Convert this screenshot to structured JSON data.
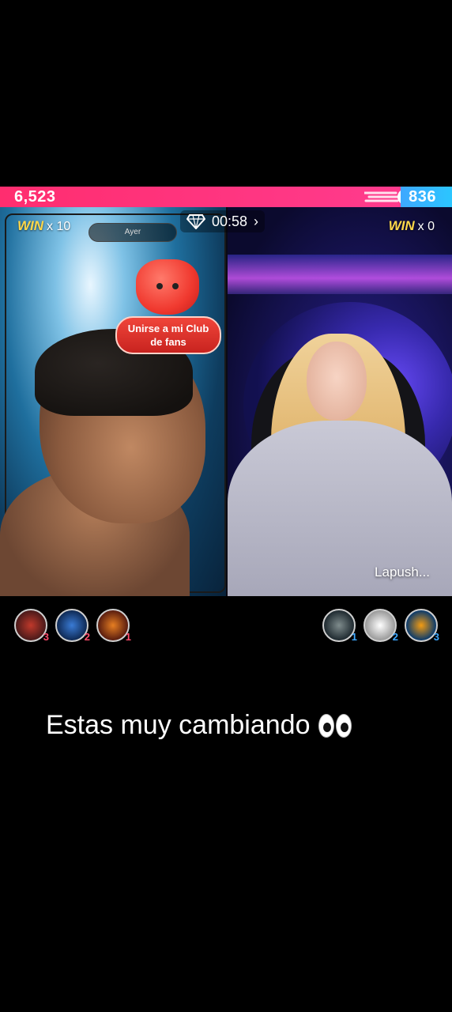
{
  "battle": {
    "left_score": "6,523",
    "right_score": "836",
    "left_share": 0.886,
    "colors": {
      "left": "#ff2d6f",
      "right": "#3ea8ff"
    }
  },
  "timer": {
    "icon": "diamond-icon",
    "value": "00:58",
    "chevron": "›"
  },
  "left_host": {
    "win_word": "WIN",
    "win_count": "x 10",
    "notch_text": "Ayer",
    "fanclub": {
      "line1": "Unirse a mi Club",
      "line2": "de fans"
    }
  },
  "right_host": {
    "win_word": "WIN",
    "win_count": "x 0",
    "name": "Lapush..."
  },
  "supporters": {
    "left": [
      {
        "rank": "3",
        "rank_color": "#ff4d6d"
      },
      {
        "rank": "2",
        "rank_color": "#ff4d6d"
      },
      {
        "rank": "1",
        "rank_color": "#ff4d6d"
      }
    ],
    "right": [
      {
        "rank": "1",
        "rank_color": "#3ea8ff"
      },
      {
        "rank": "2",
        "rank_color": "#3ea8ff"
      },
      {
        "rank": "3",
        "rank_color": "#3ea8ff"
      }
    ]
  },
  "caption": {
    "text": "Estas muy cambiando",
    "emoji": "eyes-emoji"
  }
}
